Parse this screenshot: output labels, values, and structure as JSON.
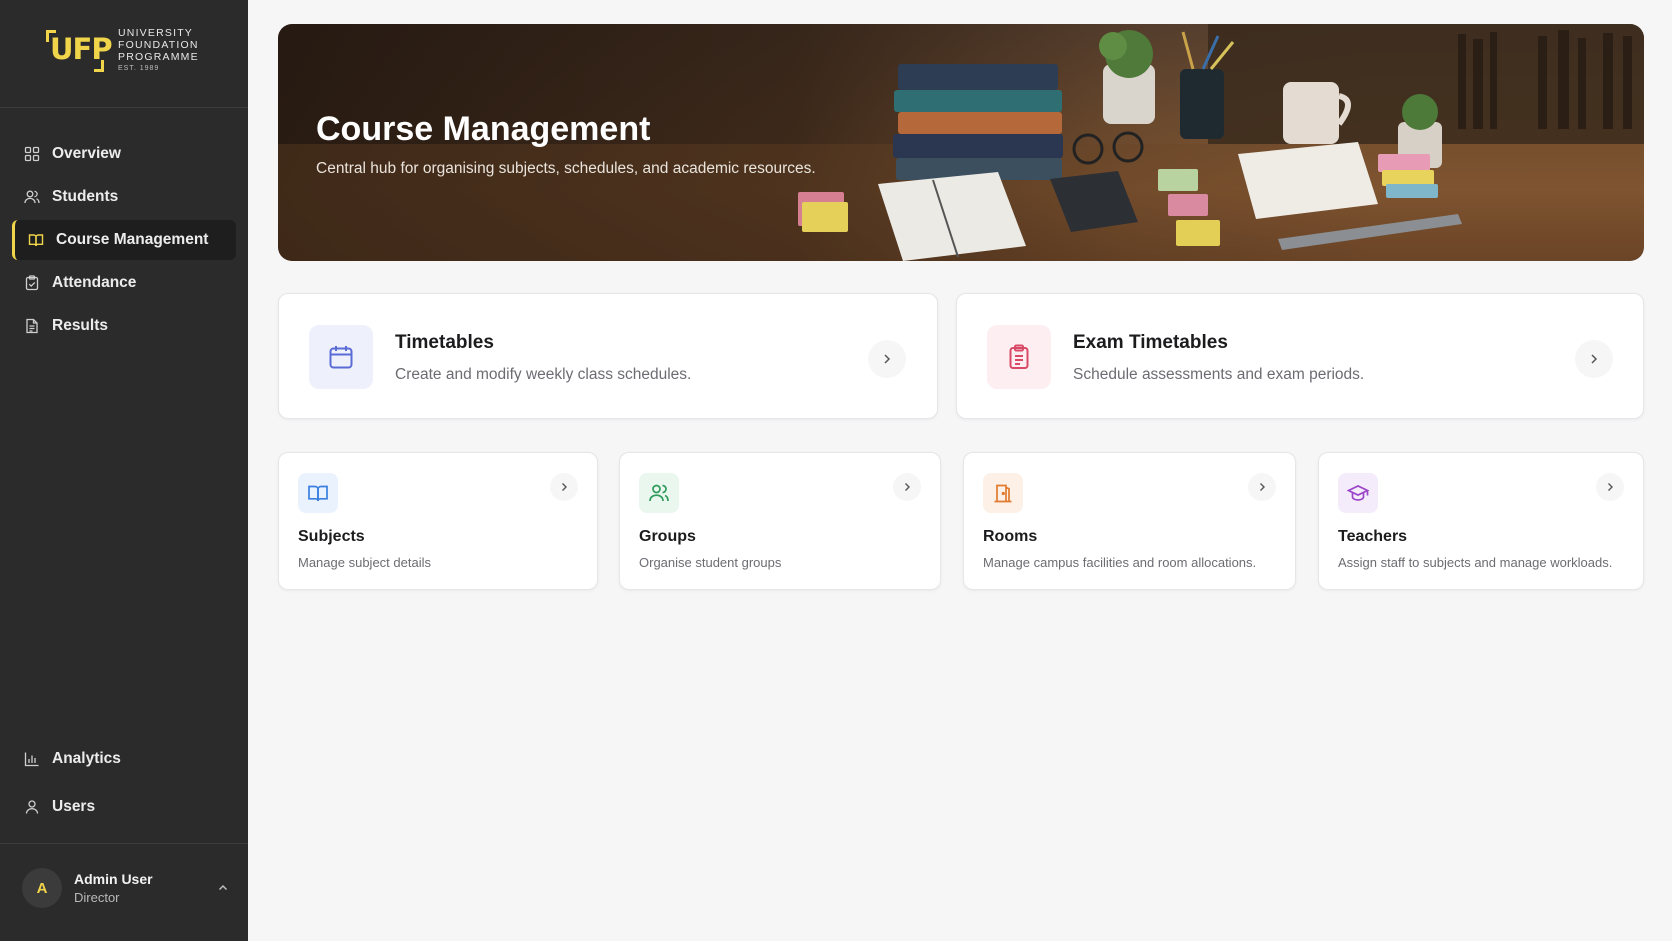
{
  "brand": {
    "mark": "UFP",
    "line1": "UNIVERSITY",
    "line2": "FOUNDATION",
    "line3": "PROGRAMME",
    "est": "EST. 1989",
    "accent_color": "#f0d44a"
  },
  "sidebar": {
    "nav": [
      {
        "label": "Overview",
        "icon": "grid-icon"
      },
      {
        "label": "Students",
        "icon": "students-icon"
      },
      {
        "label": "Course Management",
        "icon": "book-open-icon",
        "active": true
      },
      {
        "label": "Attendance",
        "icon": "clipboard-check-icon"
      },
      {
        "label": "Results",
        "icon": "document-icon"
      }
    ],
    "bottom_nav": [
      {
        "label": "Analytics",
        "icon": "bar-chart-icon"
      },
      {
        "label": "Users",
        "icon": "user-icon"
      }
    ],
    "user": {
      "initial": "A",
      "name": "Admin User",
      "role": "Director"
    }
  },
  "hero": {
    "title": "Course Management",
    "subtitle": "Central hub for organising subjects, schedules, and academic resources."
  },
  "primary_cards": [
    {
      "title": "Timetables",
      "description": "Create and modify weekly class schedules.",
      "icon": "calendar-icon",
      "color": "#5b6bd6",
      "tile": "#eef0fb"
    },
    {
      "title": "Exam Timetables",
      "description": "Schedule assessments and exam periods.",
      "icon": "clipboard-list-icon",
      "color": "#d94a67",
      "tile": "#fdeef1"
    }
  ],
  "secondary_cards": [
    {
      "title": "Subjects",
      "description": "Manage subject details",
      "icon": "book-icon",
      "color": "#3a7fe0",
      "tile": "#eaf2fd"
    },
    {
      "title": "Groups",
      "description": "Organise student groups",
      "icon": "users-icon",
      "color": "#2e9b5b",
      "tile": "#e9f7ef"
    },
    {
      "title": "Rooms",
      "description": "Manage campus facilities and room allocations.",
      "icon": "door-icon",
      "color": "#e07a2e",
      "tile": "#fdf1e7"
    },
    {
      "title": "Teachers",
      "description": "Assign staff to subjects and manage workloads.",
      "icon": "graduation-cap-icon",
      "color": "#9b46c9",
      "tile": "#f5ecfb"
    }
  ]
}
